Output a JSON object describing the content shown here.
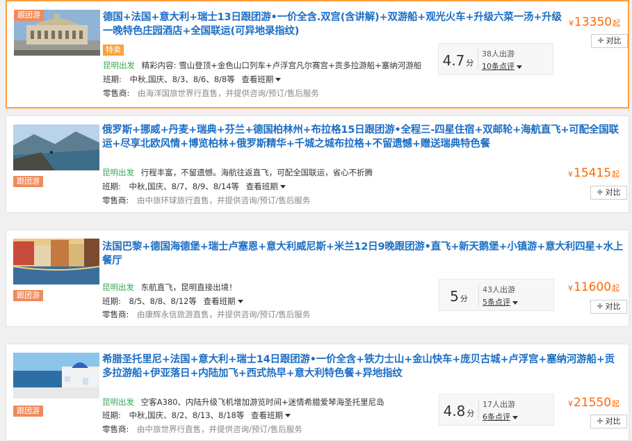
{
  "common": {
    "depart_label": "昆明出发",
    "schedule_label": "班期:",
    "schedule_link": "查看班期",
    "retailer_label": "零售商:",
    "compare_label": "对比",
    "tag_label": "跟团游",
    "currency": "¥",
    "price_suffix": "起",
    "score_unit": "分"
  },
  "listings": [
    {
      "title": "德国+法国+意大利+瑞士13日跟团游•一价全含.双宫(含讲解)+双游船+观光火车+升级六菜一汤+升级一晚特色庄园酒店+全国联运(可异地录指纹)",
      "badge": "特卖",
      "feature_prefix": "精彩内容:",
      "feature_text": "雪山登顶+金色山口列车+卢浮宫凡尔赛宫+贡多拉游船+塞纳河游船",
      "schedule": "中秋,国庆、8/3、8/6、8/8等",
      "retailer": "由海洋国旅世界行",
      "retailer_suffix": "直售，并提供咨询/预订/售后服务",
      "score": "4.7",
      "travelers": "38人出游",
      "reviews": "10条点评",
      "price": "13350"
    },
    {
      "title": "俄罗斯+挪威+丹麦+瑞典+芬兰+德国柏林州+布拉格15日跟团游•全程三-四星住宿+双邮轮+海航直飞+可配全国联运+尽享北欧风情+博览柏林+俄罗斯精华+千城之城布拉格+不留遗憾+赠送瑞典特色餐",
      "feature_text": "行程丰富，不留遗憾。海航往返直飞，可配全国联运，省心不折腾",
      "schedule": "中秋,国庆、8/7、8/9、8/14等",
      "retailer": "由中旅环球旅行",
      "retailer_suffix": "直售，并提供咨询/预订/售后服务",
      "price": "15415"
    },
    {
      "title": "法国巴黎+德国海德堡+瑞士卢塞恩+意大利威尼斯+米兰12日9晚跟团游•直飞+新天鹅堡+小镇游+意大利四星+水上餐厅",
      "feature_text": "东航直飞，昆明直接出境！",
      "schedule": "8/5、8/8、8/12等",
      "retailer": "由康辉永信旅游",
      "retailer_suffix": "直售，并提供咨询/预订/售后服务",
      "score": "5",
      "travelers": "43人出游",
      "reviews": "5条点评",
      "price": "11600"
    },
    {
      "title": "希腊圣托里尼+法国+意大利+瑞士14日跟团游•一价全含+铁力士山+金山快车+庞贝古城+卢浮宫+塞纳河游船+贡多拉游船+伊亚落日+内陆加飞+西式热早+意大利特色餐+异地指纹",
      "feature_text": "空客A380、内陆升级飞机增加游览时间+迷情希腊爱琴海圣托里尼岛",
      "schedule": "中秋,国庆、8/2、8/13、8/18等",
      "retailer": "由中旅世界行",
      "retailer_suffix": "直售，并提供咨询/预订/售后服务",
      "score": "4.8",
      "travelers": "17人出游",
      "reviews": "6条点评",
      "price": "21550"
    }
  ]
}
